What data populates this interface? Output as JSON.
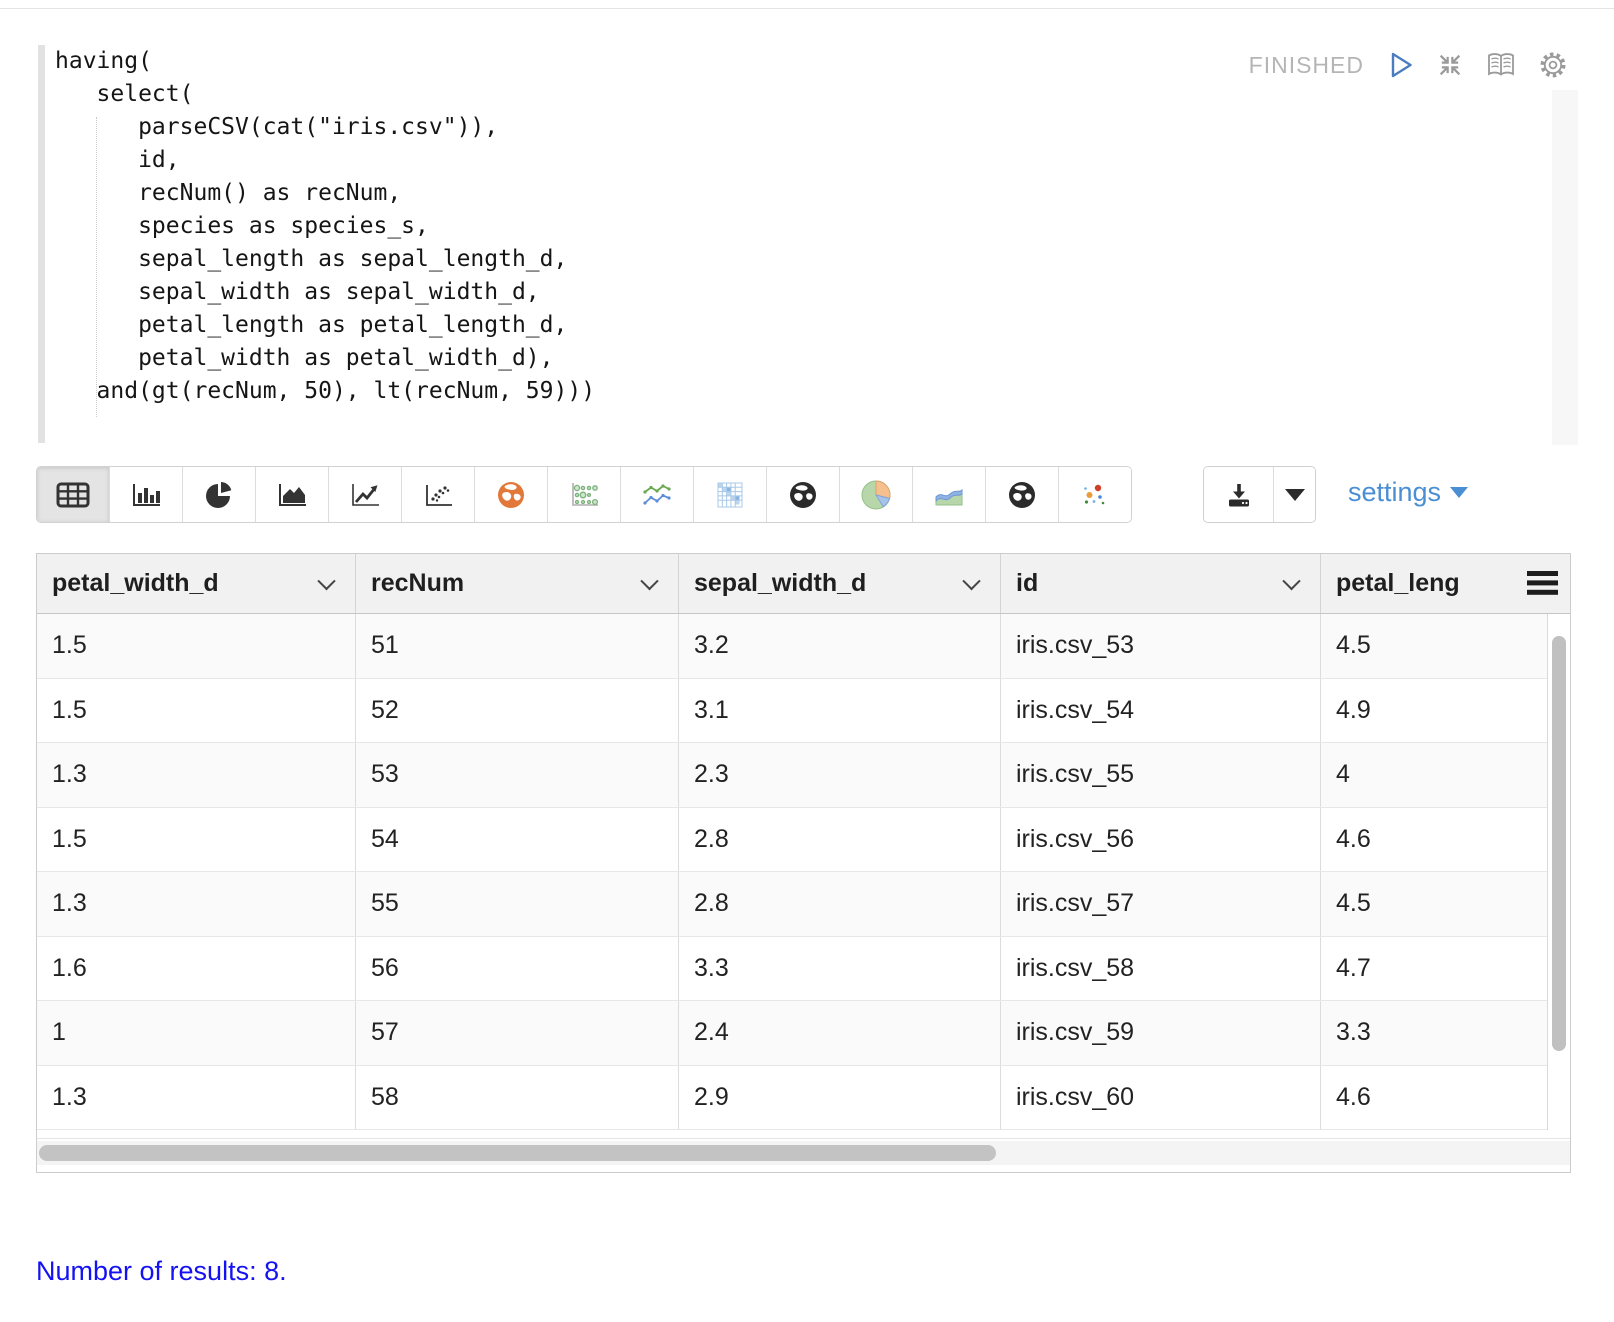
{
  "editor": {
    "status": "FINISHED",
    "code_lines": [
      "having(",
      "   select(",
      "      parseCSV(cat(\"iris.csv\")),",
      "      id,",
      "      recNum() as recNum,",
      "      species as species_s,",
      "      sepal_length as sepal_length_d,",
      "      sepal_width as sepal_width_d,",
      "      petal_length as petal_length_d,",
      "      petal_width as petal_width_d),",
      "   and(gt(recNum, 50), lt(recNum, 59)))"
    ]
  },
  "toolbar": {
    "chart_buttons": [
      {
        "name": "table",
        "selected": true
      },
      {
        "name": "bar-chart",
        "selected": false
      },
      {
        "name": "pie-chart",
        "selected": false
      },
      {
        "name": "area-chart",
        "selected": false
      },
      {
        "name": "line-chart",
        "selected": false
      },
      {
        "name": "scatter-chart",
        "selected": false
      },
      {
        "name": "map-globe-orange",
        "selected": false
      },
      {
        "name": "bubble-matrix-chart",
        "selected": false
      },
      {
        "name": "multi-line-chart",
        "selected": false
      },
      {
        "name": "correlation-grid-chart",
        "selected": false
      },
      {
        "name": "globe-dark-1",
        "selected": false
      },
      {
        "name": "pie-chart-color",
        "selected": false
      },
      {
        "name": "stream-area-chart",
        "selected": false
      },
      {
        "name": "globe-dark-2",
        "selected": false
      },
      {
        "name": "scatter-chart-color",
        "selected": false
      }
    ],
    "settings_label": "settings"
  },
  "icons": {
    "run": "play-triangle-outline",
    "collapse": "compress-arrows",
    "reader": "open-book",
    "gear": "gear-dashed-ring",
    "download": "download-tray",
    "sort": "chevron-down",
    "columns_menu": "hamburger-three-bars",
    "dropdown": "caret-down"
  },
  "table": {
    "columns": [
      "petal_width_d",
      "recNum",
      "sepal_width_d",
      "id",
      "petal_leng"
    ],
    "rows": [
      [
        "1.5",
        "51",
        "3.2",
        "iris.csv_53",
        "4.5"
      ],
      [
        "1.5",
        "52",
        "3.1",
        "iris.csv_54",
        "4.9"
      ],
      [
        "1.3",
        "53",
        "2.3",
        "iris.csv_55",
        "4"
      ],
      [
        "1.5",
        "54",
        "2.8",
        "iris.csv_56",
        "4.6"
      ],
      [
        "1.3",
        "55",
        "2.8",
        "iris.csv_57",
        "4.5"
      ],
      [
        "1.6",
        "56",
        "3.3",
        "iris.csv_58",
        "4.7"
      ],
      [
        "1",
        "57",
        "2.4",
        "iris.csv_59",
        "3.3"
      ],
      [
        "1.3",
        "58",
        "2.9",
        "iris.csv_60",
        "4.6"
      ]
    ]
  },
  "footer": {
    "results_text": "Number of results: 8."
  },
  "colors": {
    "accent_blue": "#4a8ed4",
    "result_blue": "#1412f2",
    "status_gray": "#b5b5b5",
    "play_blue": "#4a7cc0"
  }
}
